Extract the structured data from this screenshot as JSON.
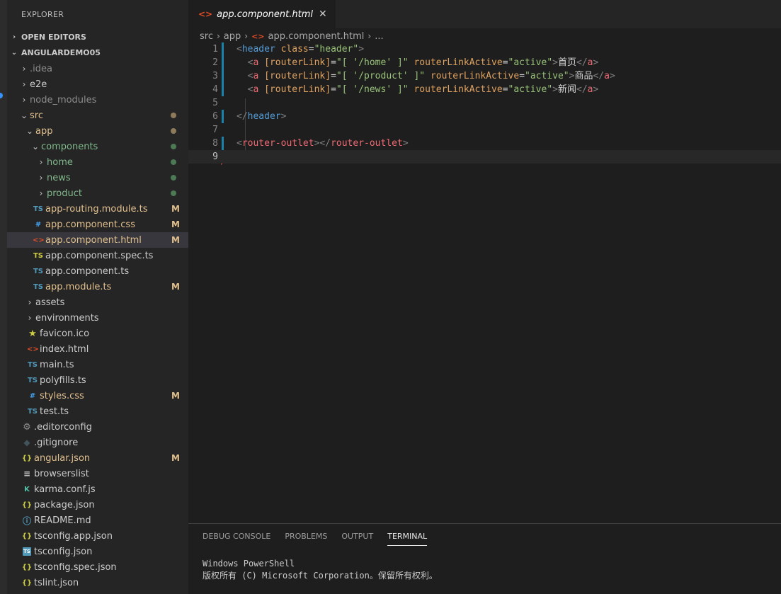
{
  "sidebar": {
    "title": "EXPLORER",
    "sections": [
      {
        "label": "OPEN EDITORS",
        "expanded": false
      },
      {
        "label": "ANGULARDEMO05",
        "expanded": true
      }
    ],
    "tree": [
      {
        "label": ".idea",
        "chevron": "›",
        "icon": "",
        "status": "dim"
      },
      {
        "label": "e2e",
        "chevron": "›",
        "icon": "",
        "status": ""
      },
      {
        "label": "node_modules",
        "chevron": "›",
        "icon": "",
        "status": "dim"
      },
      {
        "label": "src",
        "chevron": "⌄",
        "icon": "",
        "status": "mod-dot"
      },
      {
        "label": "app",
        "chevron": "⌄",
        "icon": "",
        "status": "mod-dot"
      },
      {
        "label": "components",
        "chevron": "⌄",
        "icon": "",
        "status": "add-dot"
      },
      {
        "label": "home",
        "chevron": "›",
        "icon": "",
        "status": "add-dot"
      },
      {
        "label": "news",
        "chevron": "›",
        "icon": "",
        "status": "add-dot"
      },
      {
        "label": "product",
        "chevron": "›",
        "icon": "",
        "status": "add-dot"
      },
      {
        "label": "app-routing.module.ts",
        "icon": "TS",
        "status": "M"
      },
      {
        "label": "app.component.css",
        "icon": "#",
        "status": "M"
      },
      {
        "label": "app.component.html",
        "icon": "<>",
        "status": "M",
        "selected": true
      },
      {
        "label": "app.component.spec.ts",
        "icon": "TS",
        "status": ""
      },
      {
        "label": "app.component.ts",
        "icon": "TS",
        "status": ""
      },
      {
        "label": "app.module.ts",
        "icon": "TS",
        "status": "M"
      },
      {
        "label": "assets",
        "chevron": "›",
        "icon": "",
        "status": ""
      },
      {
        "label": "environments",
        "chevron": "›",
        "icon": "",
        "status": ""
      },
      {
        "label": "favicon.ico",
        "icon": "★",
        "status": ""
      },
      {
        "label": "index.html",
        "icon": "<>",
        "status": ""
      },
      {
        "label": "main.ts",
        "icon": "TS",
        "status": ""
      },
      {
        "label": "polyfills.ts",
        "icon": "TS",
        "status": ""
      },
      {
        "label": "styles.css",
        "icon": "#",
        "status": "M"
      },
      {
        "label": "test.ts",
        "icon": "TS",
        "status": ""
      },
      {
        "label": ".editorconfig",
        "icon": "⚙",
        "status": ""
      },
      {
        "label": ".gitignore",
        "icon": "◆",
        "status": ""
      },
      {
        "label": "angular.json",
        "icon": "{}",
        "status": "M"
      },
      {
        "label": "browserslist",
        "icon": "≡",
        "status": ""
      },
      {
        "label": "karma.conf.js",
        "icon": "K",
        "status": ""
      },
      {
        "label": "package.json",
        "icon": "{}",
        "status": ""
      },
      {
        "label": "README.md",
        "icon": "ⓘ",
        "status": ""
      },
      {
        "label": "tsconfig.app.json",
        "icon": "{}",
        "status": ""
      },
      {
        "label": "tsconfig.json",
        "icon": "TS",
        "status": ""
      },
      {
        "label": "tsconfig.spec.json",
        "icon": "{}",
        "status": ""
      },
      {
        "label": "tslint.json",
        "icon": "{}",
        "status": ""
      }
    ]
  },
  "editor": {
    "tab": {
      "label": "app.component.html",
      "icon": "<>",
      "close": "✕"
    },
    "breadcrumb": {
      "parts": [
        "src",
        "app"
      ],
      "file": "app.component.html",
      "tail": "..."
    },
    "current_line": 9,
    "lines": [
      {
        "n": "1",
        "tokens": [
          [
            "tg",
            "<"
          ],
          [
            "tn",
            "header"
          ],
          [
            "tx",
            " "
          ],
          [
            "at",
            "class"
          ],
          [
            "tx",
            "="
          ],
          [
            "av",
            "\"header\""
          ],
          [
            "tg",
            ">"
          ]
        ]
      },
      {
        "n": "2",
        "tokens": [
          [
            "tx",
            "  "
          ],
          [
            "tg",
            "<"
          ],
          [
            "tn2",
            "a"
          ],
          [
            "tx",
            " "
          ],
          [
            "at",
            "[routerLink]"
          ],
          [
            "tx",
            "="
          ],
          [
            "av",
            "\"[ '/home' ]\""
          ],
          [
            "tx",
            " "
          ],
          [
            "at",
            "routerLinkActive"
          ],
          [
            "tx",
            "="
          ],
          [
            "av",
            "\"active\""
          ],
          [
            "tg",
            ">"
          ],
          [
            "tx",
            "首页"
          ],
          [
            "tg",
            "</"
          ],
          [
            "tn2",
            "a"
          ],
          [
            "tg",
            ">"
          ]
        ]
      },
      {
        "n": "3",
        "tokens": [
          [
            "tx",
            "  "
          ],
          [
            "tg",
            "<"
          ],
          [
            "tn2",
            "a"
          ],
          [
            "tx",
            " "
          ],
          [
            "at",
            "[routerLink]"
          ],
          [
            "tx",
            "="
          ],
          [
            "av",
            "\"[ '/product' ]\""
          ],
          [
            "tx",
            " "
          ],
          [
            "at",
            "routerLinkActive"
          ],
          [
            "tx",
            "="
          ],
          [
            "av",
            "\"active\""
          ],
          [
            "tg",
            ">"
          ],
          [
            "tx",
            "商品"
          ],
          [
            "tg",
            "</"
          ],
          [
            "tn2",
            "a"
          ],
          [
            "tg",
            ">"
          ]
        ]
      },
      {
        "n": "4",
        "tokens": [
          [
            "tx",
            "  "
          ],
          [
            "tg",
            "<"
          ],
          [
            "tn2",
            "a"
          ],
          [
            "tx",
            " "
          ],
          [
            "at",
            "[routerLink]"
          ],
          [
            "tx",
            "="
          ],
          [
            "av",
            "\"[ '/news' ]\""
          ],
          [
            "tx",
            " "
          ],
          [
            "at",
            "routerLinkActive"
          ],
          [
            "tx",
            "="
          ],
          [
            "av",
            "\"active\""
          ],
          [
            "tg",
            ">"
          ],
          [
            "tx",
            "新闻"
          ],
          [
            "tg",
            "</"
          ],
          [
            "tn2",
            "a"
          ],
          [
            "tg",
            ">"
          ]
        ]
      },
      {
        "n": "5",
        "tokens": []
      },
      {
        "n": "6",
        "tokens": [
          [
            "tg",
            "</"
          ],
          [
            "tn",
            "header"
          ],
          [
            "tg",
            ">"
          ]
        ]
      },
      {
        "n": "7",
        "tokens": []
      },
      {
        "n": "8",
        "tokens": [
          [
            "tg",
            "<"
          ],
          [
            "tn2",
            "router-outlet"
          ],
          [
            "tg",
            "></"
          ],
          [
            "tn2",
            "router-outlet"
          ],
          [
            "tg",
            ">"
          ]
        ]
      },
      {
        "n": "9",
        "tokens": []
      }
    ],
    "gutter": {
      "1": "mod",
      "2": "mod",
      "3": "mod",
      "4": "mod",
      "6": "mod",
      "8": "mod"
    }
  },
  "panel": {
    "tabs": [
      "DEBUG CONSOLE",
      "PROBLEMS",
      "OUTPUT",
      "TERMINAL"
    ],
    "active_tab": "TERMINAL",
    "terminal_lines": [
      "Windows PowerShell",
      "版权所有 (C) Microsoft Corporation。保留所有权利。"
    ]
  }
}
